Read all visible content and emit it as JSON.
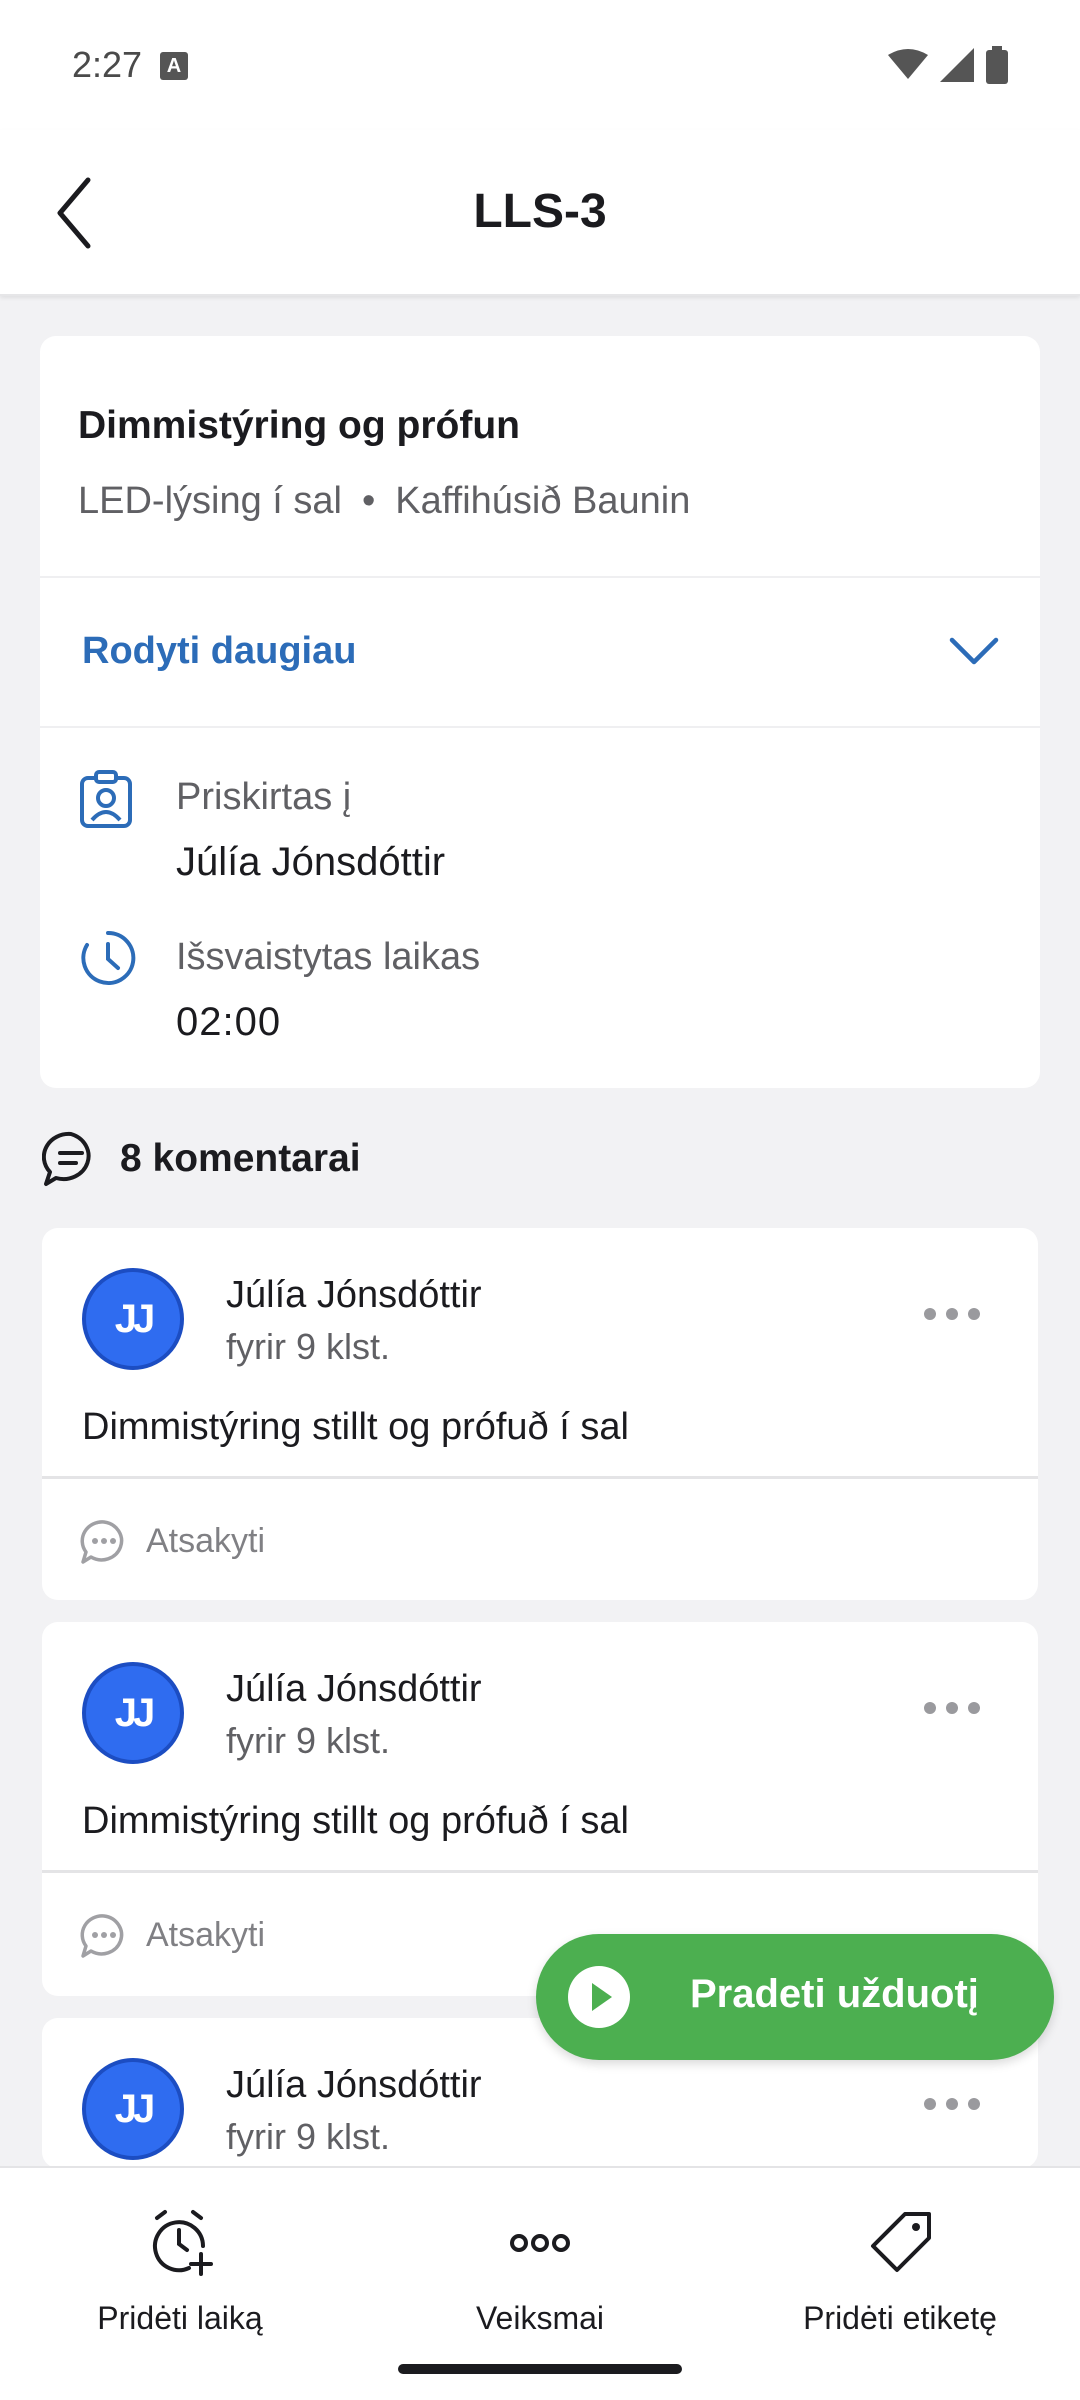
{
  "status_bar": {
    "time": "2:27",
    "notification_badge": "A"
  },
  "header": {
    "title": "LLS-3"
  },
  "task": {
    "title": "Dimmistýring og prófun",
    "subtitle_left": "LED-lýsing í sal",
    "subtitle_separator": "•",
    "subtitle_right": "Kaffihúsið Baunin",
    "show_more_label": "Rodyti daugiau",
    "assigned_label": "Priskirtas į",
    "assigned_value": "Júlía Jónsdóttir",
    "time_label": "Išsvaistytas laikas",
    "time_value": "02:00"
  },
  "comments": {
    "count_label": "8 komentarai",
    "items": [
      {
        "initials": "JJ",
        "author": "Júlía Jónsdóttir",
        "time": "fyrir 9 klst.",
        "text": "Dimmistýring stillt og prófuð í sal",
        "reply_label": "Atsakyti"
      },
      {
        "initials": "JJ",
        "author": "Júlía Jónsdóttir",
        "time": "fyrir 9 klst.",
        "text": "Dimmistýring stillt og prófuð í sal",
        "reply_label": "Atsakyti"
      },
      {
        "initials": "JJ",
        "author": "Júlía Jónsdóttir",
        "time": "fyrir 9 klst."
      }
    ]
  },
  "fab": {
    "label": "Pradeti užduotį",
    "color": "#4caf50"
  },
  "bottom_nav": {
    "items": [
      {
        "label": "Pridėti laiką",
        "icon": "add-time-icon"
      },
      {
        "label": "Veiksmai",
        "icon": "more-horizontal-icon"
      },
      {
        "label": "Pridėti etiketę",
        "icon": "tag-icon"
      }
    ]
  },
  "colors": {
    "accent_link": "#2c6cb8",
    "avatar": "#2f6cf0",
    "background": "#f2f2f4"
  }
}
